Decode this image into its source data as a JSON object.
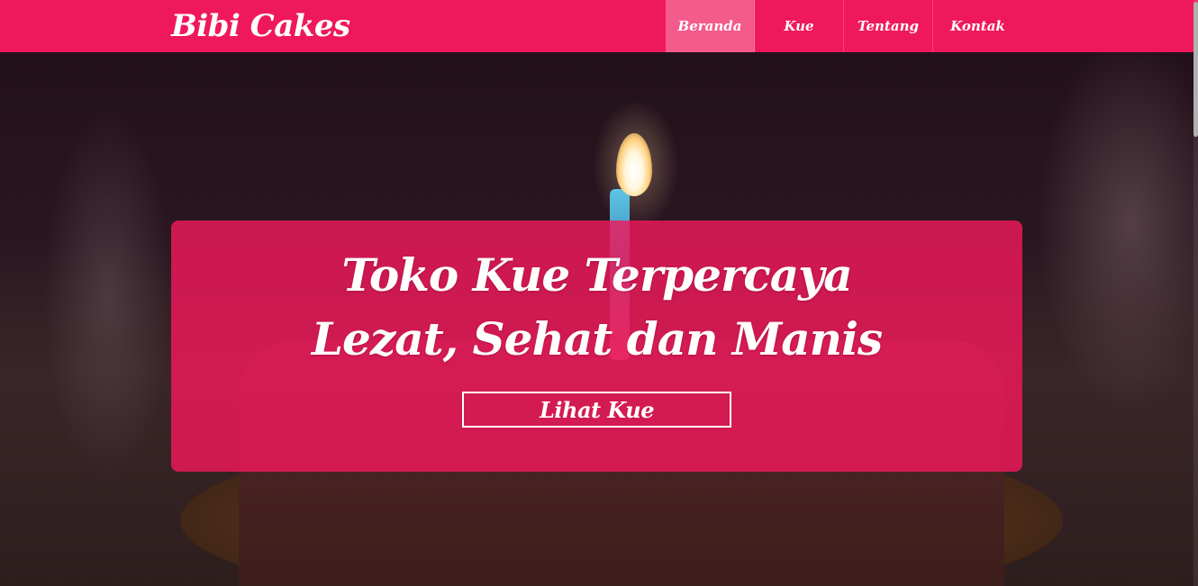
{
  "brand": {
    "name": "Bibi Cakes"
  },
  "nav": {
    "items": [
      {
        "label": "Beranda",
        "active": true
      },
      {
        "label": "Kue",
        "active": false
      },
      {
        "label": "Tentang",
        "active": false
      },
      {
        "label": "Kontak",
        "active": false
      }
    ]
  },
  "hero": {
    "headline_line1": "Toko Kue Terpercaya",
    "headline_line2": "Lezat, Sehat dan Manis",
    "cta_label": "Lihat Kue"
  },
  "colors": {
    "brand_pink": "#f0185c",
    "active_nav": "#f45a8b",
    "text": "#ffffff"
  }
}
